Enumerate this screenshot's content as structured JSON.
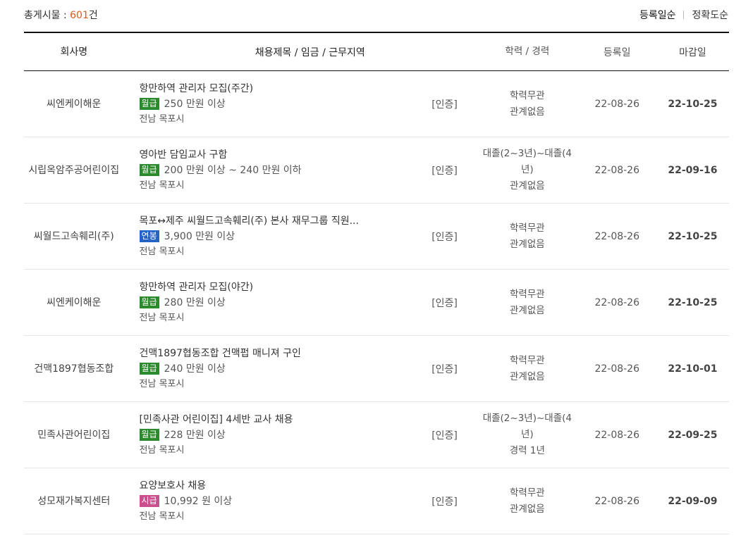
{
  "summary": {
    "total_label": "총게시물 : ",
    "total_count": "601",
    "total_suffix": "건"
  },
  "sort": {
    "option1": "등록일순",
    "option2": "정확도순"
  },
  "headers": {
    "company": "회사명",
    "title": "채용제목 / 임금 / 근무지역",
    "edu": "학력 / 경력",
    "reg": "등록일",
    "deadline": "마감일"
  },
  "colors": {
    "monthly": "#2b8a2b",
    "annual": "#2563c4",
    "hourly": "#c94f8f",
    "count": "#e05a1b"
  },
  "rows": [
    {
      "company": "씨엔케이해운",
      "title": "항만하역 관리자 모집(주간)",
      "pay_type": "월급",
      "pay_amount": "250 만원 이상",
      "location": "전남 목포시",
      "cert": "[인증]",
      "edu": "학력무관",
      "career": "관계없음",
      "reg": "22-08-26",
      "deadline": "22-10-25"
    },
    {
      "company": "시립옥암주공어린이집",
      "title": "영아반 담임교사 구함",
      "pay_type": "월급",
      "pay_amount": "200 만원 이상 ~ 240 만원 이하",
      "location": "전남 목포시",
      "cert": "[인증]",
      "edu": "대졸(2~3년)~대졸(4년)",
      "career": "관계없음",
      "reg": "22-08-26",
      "deadline": "22-09-16"
    },
    {
      "company": "씨월드고속훼리(주)",
      "title": "목포↔제주 씨월드고속훼리(주) 본사 재무그룹 직원...",
      "pay_type": "연봉",
      "pay_amount": "3,900 만원 이상",
      "location": "전남 목포시",
      "cert": "[인증]",
      "edu": "학력무관",
      "career": "관계없음",
      "reg": "22-08-26",
      "deadline": "22-10-25"
    },
    {
      "company": "씨엔케이해운",
      "title": "항만하역 관리자 모집(야간)",
      "pay_type": "월급",
      "pay_amount": "280 만원 이상",
      "location": "전남 목포시",
      "cert": "[인증]",
      "edu": "학력무관",
      "career": "관계없음",
      "reg": "22-08-26",
      "deadline": "22-10-25"
    },
    {
      "company": "건맥1897협동조합",
      "title": "건맥1897협동조합 건맥펍 매니져 구인",
      "pay_type": "월급",
      "pay_amount": "240 만원 이상",
      "location": "전남 목포시",
      "cert": "[인증]",
      "edu": "학력무관",
      "career": "관계없음",
      "reg": "22-08-26",
      "deadline": "22-10-01"
    },
    {
      "company": "민족사관어린이집",
      "title": "[민족사관 어린이집] 4세반 교사 채용",
      "pay_type": "월급",
      "pay_amount": "228 만원 이상",
      "location": "전남 목포시",
      "cert": "[인증]",
      "edu": "대졸(2~3년)~대졸(4년)",
      "career": "경력 1년",
      "reg": "22-08-26",
      "deadline": "22-09-25"
    },
    {
      "company": "성모재가복지센터",
      "title": "요양보호사 채용",
      "pay_type": "시급",
      "pay_amount": "10,992 원 이상",
      "location": "전남 목포시",
      "cert": "[인증]",
      "edu": "학력무관",
      "career": "관계없음",
      "reg": "22-08-26",
      "deadline": "22-09-09"
    }
  ]
}
